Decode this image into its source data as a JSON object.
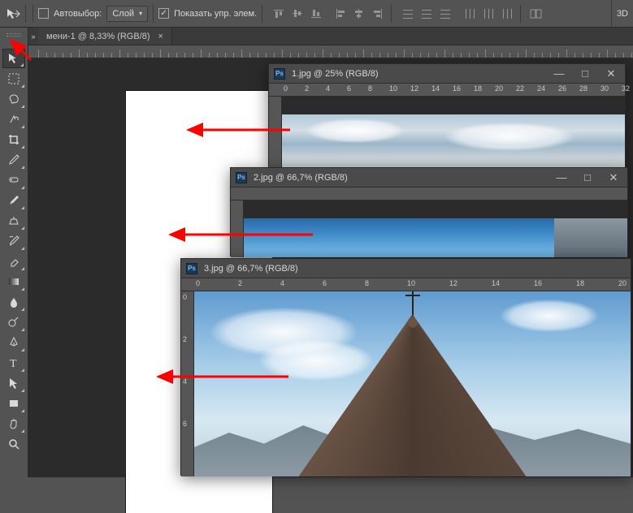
{
  "options": {
    "autoselect_label": "Автовыбор:",
    "autoselect_checked": false,
    "layer_dropdown": "Слой",
    "show_controls_label": "Показать упр. элем.",
    "show_controls_checked": true,
    "right_indicator": "3D"
  },
  "main_tab": {
    "title": "мени-1 @ 8,33% (RGB/8)"
  },
  "tools": [
    {
      "name": "move-tool",
      "active": true
    },
    {
      "name": "marquee-tool"
    },
    {
      "name": "lasso-tool"
    },
    {
      "name": "quick-select-tool"
    },
    {
      "name": "crop-tool"
    },
    {
      "name": "eyedropper-tool"
    },
    {
      "name": "healing-brush-tool"
    },
    {
      "name": "brush-tool"
    },
    {
      "name": "clone-stamp-tool"
    },
    {
      "name": "history-brush-tool"
    },
    {
      "name": "eraser-tool"
    },
    {
      "name": "gradient-tool"
    },
    {
      "name": "blur-tool"
    },
    {
      "name": "dodge-tool"
    },
    {
      "name": "pen-tool"
    },
    {
      "name": "type-tool"
    },
    {
      "name": "path-select-tool"
    },
    {
      "name": "rectangle-tool"
    },
    {
      "name": "hand-tool"
    },
    {
      "name": "zoom-tool"
    }
  ],
  "windows": [
    {
      "title": "1.jpg @ 25% (RGB/8)",
      "ruler": [
        0,
        2,
        4,
        6,
        8,
        10,
        12,
        14,
        16,
        18,
        20,
        22,
        24,
        26,
        28,
        30,
        32
      ]
    },
    {
      "title": "2.jpg @ 66,7% (RGB/8)"
    },
    {
      "title": "3.jpg @ 66,7% (RGB/8)",
      "ruler": [
        0,
        2,
        4,
        6,
        8,
        10,
        12,
        14,
        16,
        18,
        20
      ],
      "vruler": [
        0,
        2,
        4,
        6
      ]
    }
  ]
}
